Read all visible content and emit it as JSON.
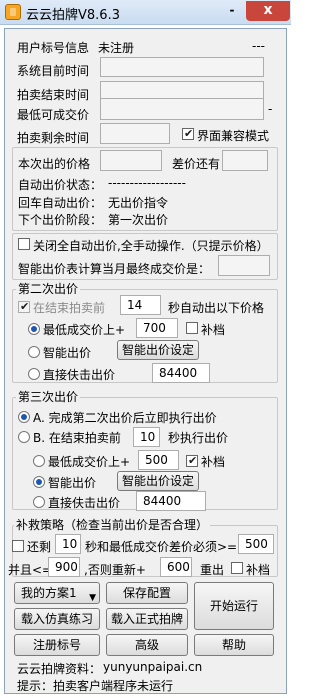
{
  "window": {
    "title": "云云拍牌V8.6.3",
    "close_label": "x",
    "minimize_label": "-"
  },
  "account": {
    "label": "用户标号信息",
    "value": "未注册",
    "extra": "---"
  },
  "times": {
    "system_time_label": "系统目前时间",
    "end_time_label": "拍卖结束时间",
    "min_price_label": "最低可成交价",
    "min_price_suffix": "-",
    "remaining_label": "拍卖剩余时间",
    "compat_label": "界面兼容模式",
    "compat_checked": true
  },
  "bid_info": {
    "this_bid_label": "本次出的价格",
    "diff_label": "差价还有",
    "auto_status_label": "自动出价状态：",
    "auto_status_value": "------------------",
    "enter_auto_label": "回车自动出价：",
    "enter_auto_value": "无出价指令",
    "next_stage_label": "下个出价阶段：",
    "next_stage_value": "第一次出价"
  },
  "manual": {
    "close_all_label": "关闭全自动出价,全手动操作.（只提示价格）",
    "smart_calc_label": "智能出价表计算当月最终成交价是："
  },
  "second_bid": {
    "legend": "第二次出价",
    "before_end_label": "在结束拍卖前",
    "before_end_value": "14",
    "before_end_suffix": "秒自动出以下价格",
    "opt_min_label": "最低成交价上+",
    "opt_min_value": "700",
    "opt_min_fill_label": "补档",
    "opt_smart_label": "智能出价",
    "smart_settings_button": "智能出价设定",
    "opt_direct_label": "直接伕击出价",
    "opt_direct_value": "84400"
  },
  "third_bid": {
    "legend": "第三次出价",
    "opt_a_label": "A. 完成第二次出价后立即执行出价",
    "opt_b_label": "B. 在结束拍卖前",
    "opt_b_value": "10",
    "opt_b_suffix": "秒执行出价",
    "opt_min_label": "最低成交价上+",
    "opt_min_value": "500",
    "opt_min_fill_label": "补档",
    "opt_smart_label": "智能出价",
    "smart_settings_button": "智能出价设定",
    "opt_direct_label": "直接伕击出价",
    "opt_direct_value": "84400"
  },
  "rescue": {
    "legend": "补救策略（检查当前出价是否合理）",
    "remain_label": "还剩",
    "remain_value": "10",
    "remain_suffix": "秒和最低成交价差价必须>=",
    "diff_value": "500",
    "and_le_label": "并且<=",
    "and_le_value": "900",
    "else_label": ",否则重新+",
    "else_value": "600",
    "resubmit_label": "重出",
    "fill_label": "补档"
  },
  "buttons": {
    "plan_select": "我的方案1",
    "save_config": "保存配置",
    "start_run": "开始运行",
    "load_sim": "载入仿真练习",
    "load_real": "载入正式拍牌",
    "register": "注册标号",
    "advanced": "高级",
    "help": "帮助"
  },
  "footer": {
    "site_label": "云云拍牌资料：",
    "site_value": "yunyunpaipai.cn",
    "hint_label": "提示：",
    "hint_value": "拍卖客户端程序未运行"
  }
}
